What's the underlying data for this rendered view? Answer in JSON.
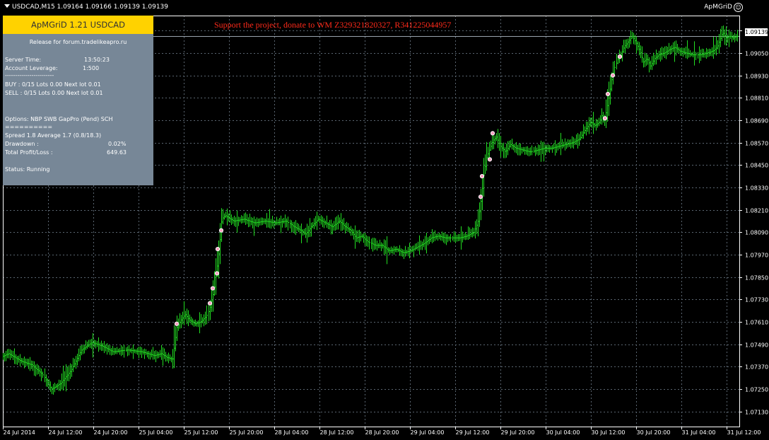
{
  "chart": {
    "symbol_header": "USDCAD,M15  1.09164 1.09166 1.09139 1.09139",
    "ea_label": "ApMGriD",
    "current_price": "1.09139",
    "donate_text": "Support the project, donate to WM Z329321820327, R341225044957",
    "colors": {
      "background": "#000000",
      "grid": "#5a6570",
      "candles": "#22dd22",
      "donate": "#ff2a1a",
      "panel": "#778797",
      "panel_header": "#ffd200"
    }
  },
  "panel": {
    "title": "ApMGriD 1.21 USDCAD",
    "release": "Release for forum.tradelikeapro.ru",
    "server_time_label": "Server Time:",
    "server_time_value": "13:50:23",
    "leverage_label": "Account Leverage:",
    "leverage_value": "1:500",
    "dashes": "------------------------",
    "buy_line": "BUY : 0/15  Lots 0.00 Next lot 0.01",
    "sell_line": "SELL : 0/15  Lots 0.00 Next lot 0.01",
    "options_line": "Options: NBP SWB GapPro (Pend) SCH",
    "equals": "==========",
    "spread_line": "Spread 1.8 Average 1.7 (0.8/18.3)",
    "drawdown_label": "Drawdown :",
    "drawdown_value": "0.02%",
    "profit_label": "Total Profit/Loss :",
    "profit_value": "649.63",
    "status_line": "Status: Running"
  },
  "chart_data": {
    "type": "candlestick",
    "symbol": "USDCAD",
    "timeframe": "M15",
    "ylim": [
      1.0705,
      1.0925
    ],
    "y_ticks": [
      "1.09170",
      "1.09050",
      "1.08930",
      "1.08810",
      "1.08690",
      "1.08570",
      "1.08450",
      "1.08330",
      "1.08210",
      "1.08090",
      "1.07970",
      "1.07850",
      "1.07730",
      "1.07610",
      "1.07490",
      "1.07370",
      "1.07250",
      "1.07130"
    ],
    "x_ticks": [
      "24 Jul 2014",
      "24 Jul 12:00",
      "24 Jul 20:00",
      "25 Jul 04:00",
      "25 Jul 12:00",
      "25 Jul 20:00",
      "28 Jul 04:00",
      "28 Jul 12:00",
      "28 Jul 20:00",
      "29 Jul 04:00",
      "29 Jul 12:00",
      "29 Jul 20:00",
      "30 Jul 04:00",
      "30 Jul 12:00",
      "30 Jul 20:00",
      "31 Jul 04:00",
      "31 Jul 12:00"
    ],
    "bar_count": 516,
    "path": [
      [
        0,
        1.0742
      ],
      [
        12,
        1.0744
      ],
      [
        30,
        1.074
      ],
      [
        45,
        1.0738
      ],
      [
        60,
        1.0733
      ],
      [
        72,
        1.0725
      ],
      [
        85,
        1.0728
      ],
      [
        100,
        1.0735
      ],
      [
        115,
        1.0746
      ],
      [
        130,
        1.075
      ],
      [
        145,
        1.0748
      ],
      [
        160,
        1.0745
      ],
      [
        180,
        1.0746
      ],
      [
        200,
        1.0745
      ],
      [
        218,
        1.0743
      ],
      [
        228,
        1.0744
      ],
      [
        236,
        1.0742
      ],
      [
        244,
        1.0741
      ],
      [
        250,
        1.0758
      ],
      [
        256,
        1.0762
      ],
      [
        262,
        1.0765
      ],
      [
        268,
        1.0762
      ],
      [
        276,
        1.076
      ],
      [
        284,
        1.0761
      ],
      [
        292,
        1.0764
      ],
      [
        296,
        1.0768
      ],
      [
        302,
        1.0778
      ],
      [
        307,
        1.0792
      ],
      [
        310,
        1.0802
      ],
      [
        313,
        1.0816
      ],
      [
        318,
        1.0818
      ],
      [
        330,
        1.0815
      ],
      [
        345,
        1.0816
      ],
      [
        360,
        1.0814
      ],
      [
        375,
        1.0815
      ],
      [
        390,
        1.0814
      ],
      [
        405,
        1.0815
      ],
      [
        415,
        1.0812
      ],
      [
        425,
        1.081
      ],
      [
        432,
        1.0808
      ],
      [
        440,
        1.0812
      ],
      [
        450,
        1.0816
      ],
      [
        460,
        1.0814
      ],
      [
        470,
        1.0812
      ],
      [
        480,
        1.0815
      ],
      [
        488,
        1.0812
      ],
      [
        496,
        1.081
      ],
      [
        504,
        1.0806
      ],
      [
        512,
        1.0807
      ],
      [
        520,
        1.0804
      ],
      [
        530,
        1.0802
      ],
      [
        540,
        1.0802
      ],
      [
        550,
        1.0799
      ],
      [
        560,
        1.08
      ],
      [
        570,
        1.0798
      ],
      [
        580,
        1.0799
      ],
      [
        590,
        1.0801
      ],
      [
        600,
        1.0803
      ],
      [
        610,
        1.0806
      ],
      [
        620,
        1.0807
      ],
      [
        630,
        1.0806
      ],
      [
        640,
        1.0806
      ],
      [
        650,
        1.0806
      ],
      [
        660,
        1.0807
      ],
      [
        670,
        1.0809
      ],
      [
        676,
        1.0815
      ],
      [
        680,
        1.0826
      ],
      [
        684,
        1.084
      ],
      [
        688,
        1.0849
      ],
      [
        693,
        1.0854
      ],
      [
        697,
        1.0858
      ],
      [
        702,
        1.086
      ],
      [
        708,
        1.0855
      ],
      [
        715,
        1.0852
      ],
      [
        722,
        1.0856
      ],
      [
        730,
        1.0854
      ],
      [
        740,
        1.0853
      ],
      [
        750,
        1.0852
      ],
      [
        760,
        1.0853
      ],
      [
        770,
        1.0854
      ],
      [
        780,
        1.0854
      ],
      [
        790,
        1.0855
      ],
      [
        800,
        1.0856
      ],
      [
        810,
        1.0857
      ],
      [
        820,
        1.0859
      ],
      [
        828,
        1.0864
      ],
      [
        836,
        1.0868
      ],
      [
        842,
        1.0866
      ],
      [
        848,
        1.0868
      ],
      [
        852,
        1.0872
      ],
      [
        855,
        1.0869
      ],
      [
        858,
        1.0874
      ],
      [
        862,
        1.0882
      ],
      [
        866,
        1.0892
      ],
      [
        870,
        1.0898
      ],
      [
        874,
        1.0902
      ],
      [
        878,
        1.0904
      ],
      [
        882,
        1.0908
      ],
      [
        886,
        1.091
      ],
      [
        890,
        1.0912
      ],
      [
        894,
        1.0914
      ],
      [
        900,
        1.091
      ],
      [
        905,
        1.0906
      ],
      [
        910,
        1.09
      ],
      [
        915,
        1.0902
      ],
      [
        920,
        1.0898
      ],
      [
        926,
        1.0902
      ],
      [
        932,
        1.0904
      ],
      [
        940,
        1.0905
      ],
      [
        948,
        1.0907
      ],
      [
        955,
        1.0908
      ],
      [
        962,
        1.0906
      ],
      [
        970,
        1.0905
      ],
      [
        980,
        1.0904
      ],
      [
        990,
        1.0904
      ],
      [
        1000,
        1.0905
      ],
      [
        1008,
        1.0906
      ],
      [
        1014,
        1.0908
      ],
      [
        1018,
        1.0912
      ],
      [
        1022,
        1.0916
      ],
      [
        1027,
        1.0913
      ],
      [
        1032,
        1.0914
      ],
      [
        1037,
        1.0913
      ],
      [
        1043,
        1.0914
      ]
    ],
    "trade_markers": [
      [
        250,
        1.076
      ],
      [
        297,
        1.0771
      ],
      [
        301,
        1.0779
      ],
      [
        307,
        1.0787
      ],
      [
        308,
        1.08
      ],
      [
        313,
        1.081
      ],
      [
        680,
        1.0828
      ],
      [
        682,
        1.0839
      ],
      [
        693,
        1.0848
      ],
      [
        697,
        1.0862
      ],
      [
        856,
        1.087
      ],
      [
        860,
        1.0883
      ],
      [
        867,
        1.0893
      ],
      [
        877,
        1.0903
      ]
    ]
  }
}
